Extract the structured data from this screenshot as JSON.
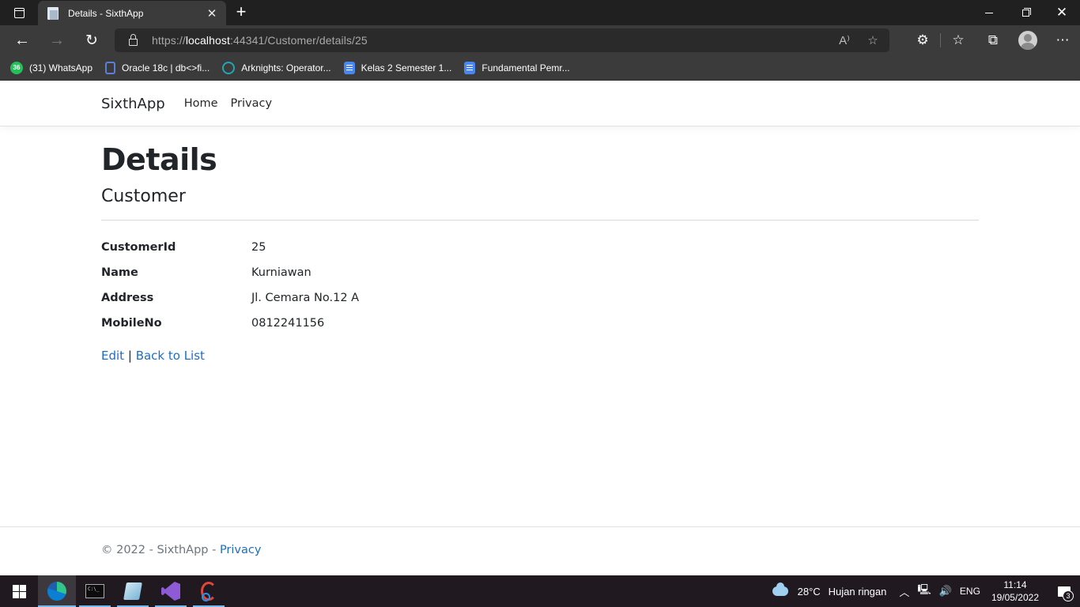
{
  "browser": {
    "tab_title": "Details - SixthApp",
    "new_tab_icon": "+",
    "url_prefix": "https://",
    "url_host": "localhost",
    "url_rest": ":44341/Customer/details/25",
    "bookmarks": [
      {
        "label": "(31) WhatsApp",
        "icon": "whatsapp-icon",
        "badge": "36"
      },
      {
        "label": "Oracle 18c | db<>fi...",
        "icon": "database-icon"
      },
      {
        "label": "Arknights: Operator...",
        "icon": "arknights-icon"
      },
      {
        "label": "Kelas 2 Semester 1...",
        "icon": "google-docs-icon"
      },
      {
        "label": "Fundamental Pemr...",
        "icon": "google-docs-icon"
      }
    ]
  },
  "site": {
    "brand": "SixthApp",
    "nav": [
      {
        "label": "Home"
      },
      {
        "label": "Privacy"
      }
    ]
  },
  "main": {
    "title": "Details",
    "subtitle": "Customer",
    "fields": [
      {
        "label": "CustomerId",
        "value": "25"
      },
      {
        "label": "Name",
        "value": "Kurniawan"
      },
      {
        "label": "Address",
        "value": "Jl. Cemara No.12 A"
      },
      {
        "label": "MobileNo",
        "value": "0812241156"
      }
    ],
    "edit_label": "Edit",
    "separator": "|",
    "back_label": "Back to List"
  },
  "footer": {
    "text": "© 2022 - SixthApp - ",
    "privacy_label": "Privacy"
  },
  "taskbar": {
    "apps": [
      "edge-icon",
      "cmd-icon",
      "notepad-icon",
      "visual-studio-icon",
      "snipping-tool-icon"
    ],
    "weather_temp": "28°C",
    "weather_desc": "Hujan ringan",
    "language": "ENG",
    "time": "11:14",
    "date": "19/05/2022",
    "notification_count": "3"
  },
  "colors": {
    "link": "#1b6ec2",
    "chrome_dark": "#202020",
    "chrome_toolbar": "#3b3b3b",
    "taskbar": "#201a20"
  }
}
